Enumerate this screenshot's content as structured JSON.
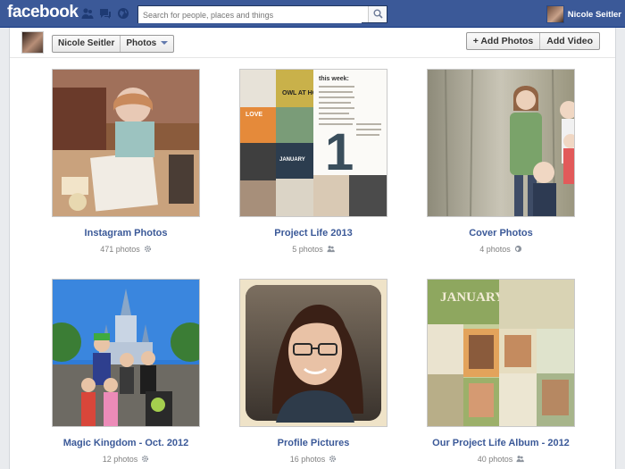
{
  "app": {
    "logo": "facebook"
  },
  "search": {
    "placeholder": "Search for people, places and things"
  },
  "user": {
    "name": "Nicole Seitler"
  },
  "breadcrumb": {
    "name": "Nicole Seitler",
    "section": "Photos"
  },
  "actions": {
    "add_photos": "+ Add Photos",
    "add_video": "Add Video"
  },
  "albums": [
    {
      "title": "Instagram Photos",
      "count": "471 photos",
      "privacy_icon": "gear-icon"
    },
    {
      "title": "Project Life 2013",
      "count": "5 photos",
      "privacy_icon": "friends-icon"
    },
    {
      "title": "Cover Photos",
      "count": "4 photos",
      "privacy_icon": "globe-icon"
    },
    {
      "title": "Magic Kingdom - Oct. 2012",
      "count": "12 photos",
      "privacy_icon": "gear-icon"
    },
    {
      "title": "Profile Pictures",
      "count": "16 photos",
      "privacy_icon": "gear-icon"
    },
    {
      "title": "Our Project Life Album - 2012",
      "count": "40 photos",
      "privacy_icon": "friends-icon"
    }
  ],
  "album_art": {
    "project_life_labels": [
      "this week:",
      "OWL AT HOME",
      "LOVE",
      "JANUARY",
      "1"
    ],
    "our_project_life_label": "JANUARY"
  },
  "colors": {
    "brand": "#3b5998",
    "link": "#3b5998",
    "muted": "#808080"
  }
}
